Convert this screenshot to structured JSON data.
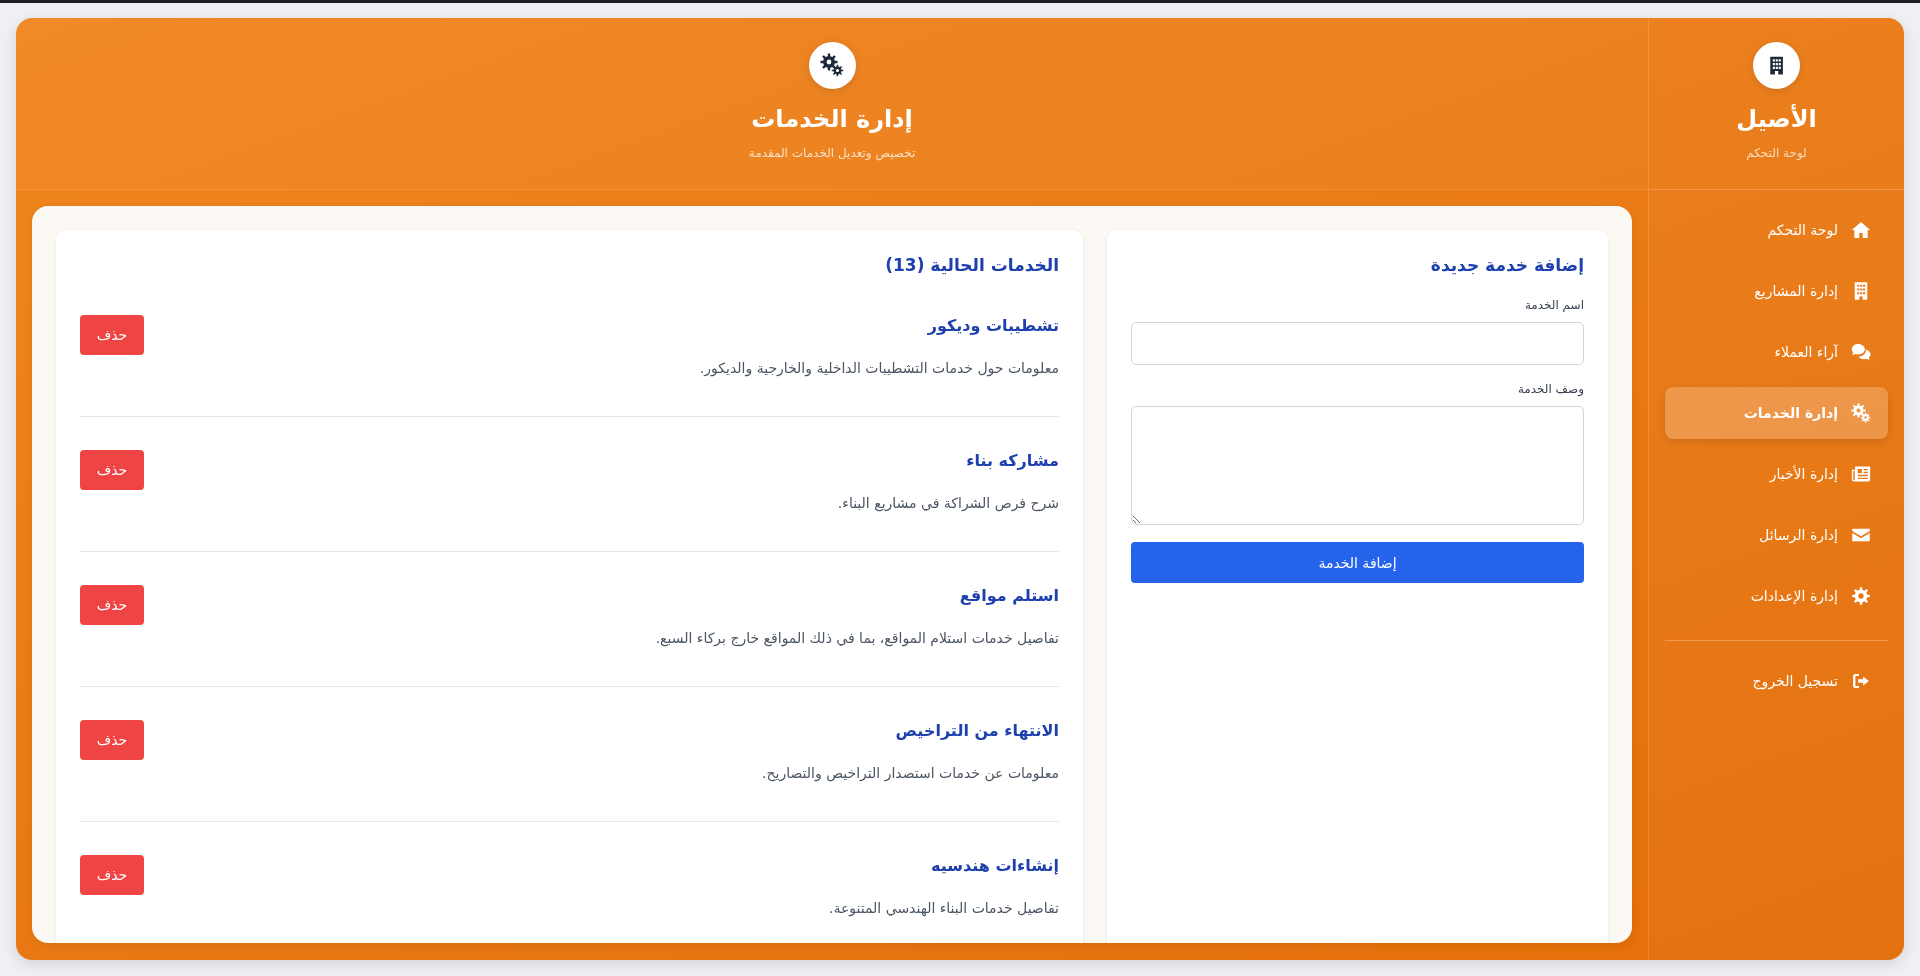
{
  "sidebar": {
    "brand": "الأصيل",
    "subtitle": "لوحة التحكم",
    "items": [
      {
        "label": "لوحة التحكم",
        "selected": false
      },
      {
        "label": "إدارة المشاريع",
        "selected": false
      },
      {
        "label": "آراء العملاء",
        "selected": false
      },
      {
        "label": "إدارة الخدمات",
        "selected": true
      },
      {
        "label": "إدارة الأخبار",
        "selected": false
      },
      {
        "label": "إدارة الرسائل",
        "selected": false
      },
      {
        "label": "إدارة الإعدادات",
        "selected": false
      }
    ],
    "logout": {
      "label": "تسجيل الخروج"
    }
  },
  "header": {
    "title": "إدارة الخدمات",
    "subtitle": "تخصيص وتعديل الخدمات المقدمة"
  },
  "form": {
    "title": "إضافة خدمة جديدة",
    "fields": [
      {
        "kind": "input",
        "label": "اسم الخدمة"
      },
      {
        "kind": "textarea",
        "label": "وصف الخدمة"
      }
    ],
    "submit": "إضافة الخدمة"
  },
  "services": {
    "title": "الخدمات الحالية (13)",
    "items": [
      {
        "name": "تشطيبات وديكور",
        "description": "معلومات حول خدمات التشطيبات الداخلية والخارجية والديكور.",
        "delete_label": "حذف"
      },
      {
        "name": "مشاركه بناء",
        "description": "شرح فرص الشراكة في مشاريع البناء.",
        "delete_label": "حذف"
      },
      {
        "name": "استلم مواقع",
        "description": "تفاصيل خدمات استلام المواقع، بما في ذلك المواقع خارج بركاء السبع.",
        "delete_label": "حذف"
      },
      {
        "name": "الانتهاء من التراخيص",
        "description": "معلومات عن خدمات استصدار التراخيص والتصاريح.",
        "delete_label": "حذف"
      },
      {
        "name": "إنشاءات هندسيه",
        "description": "تفاصيل خدمات البناء الهندسي المتنوعة.",
        "delete_label": "حذف"
      }
    ]
  }
}
